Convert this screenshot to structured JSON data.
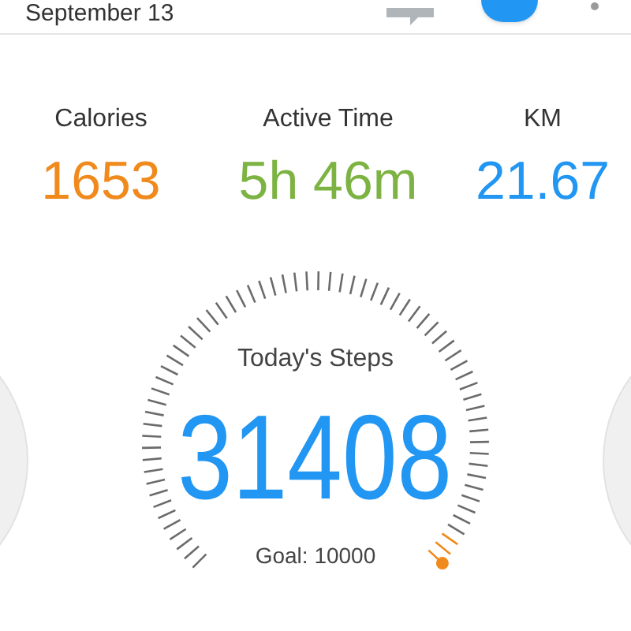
{
  "header": {
    "title": "September 13"
  },
  "stats": [
    {
      "label": "Calories",
      "value": "1653",
      "color": "#f08a1c"
    },
    {
      "label": "Active Time",
      "value": "5h 46m",
      "color": "#7cb342"
    },
    {
      "label": "KM",
      "value": "21.67",
      "color": "#2196f3"
    }
  ],
  "gauge": {
    "title": "Today's Steps",
    "steps": "31408",
    "goal": "Goal: 10000"
  }
}
